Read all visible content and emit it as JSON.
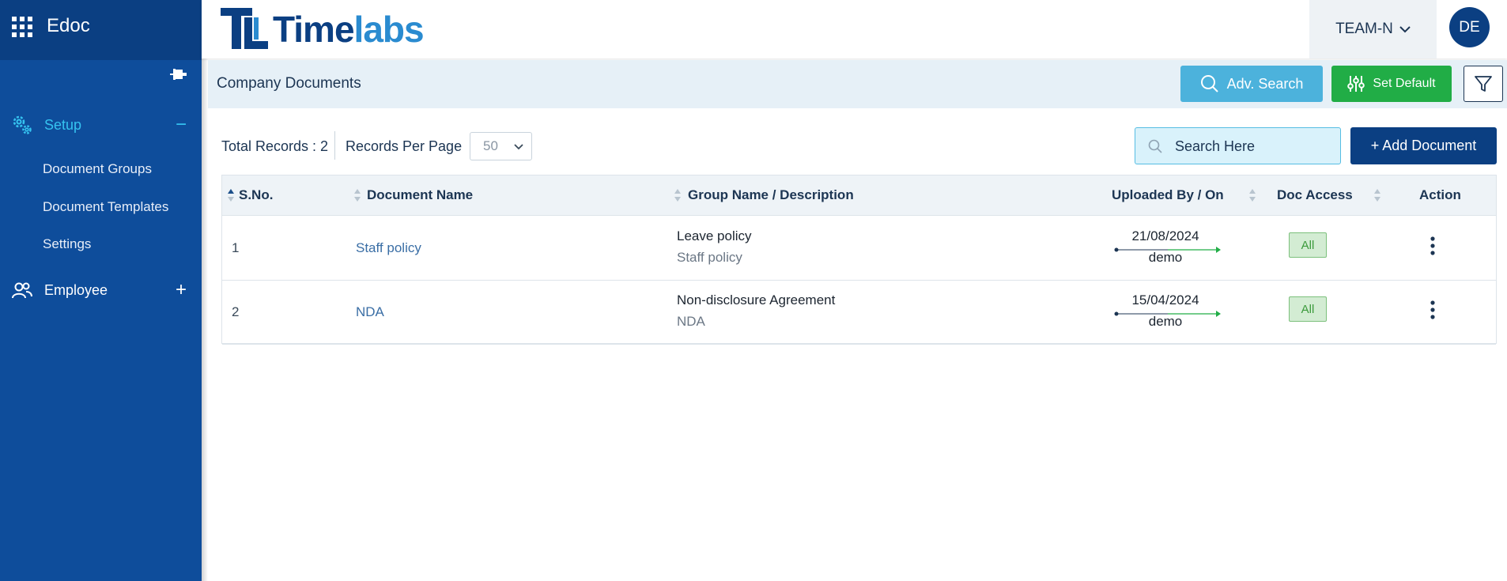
{
  "app": {
    "name": "Edoc"
  },
  "sidebar": {
    "sections": [
      {
        "label": "Setup",
        "toggle": "−",
        "active": true,
        "items": [
          {
            "label": "Document Groups"
          },
          {
            "label": "Document Templates"
          },
          {
            "label": "Settings"
          }
        ]
      },
      {
        "label": "Employee",
        "toggle": "+",
        "active": false,
        "items": []
      }
    ]
  },
  "header": {
    "logo_text_dark": "Time",
    "logo_text_light": "labs",
    "team": "TEAM-N",
    "avatar_initials": "DE"
  },
  "page": {
    "title": "Company Documents",
    "adv_search_label": "Adv. Search",
    "set_default_label": "Set Default",
    "total_records_label": "Total Records : 2",
    "records_per_page_label": "Records Per Page",
    "records_per_page_value": "50",
    "search_placeholder": "Search Here",
    "add_document_label": "+ Add Document"
  },
  "table": {
    "columns": [
      "S.No.",
      "Document Name",
      "Group Name / Description",
      "Uploaded By / On",
      "Doc Access",
      "Action"
    ],
    "rows": [
      {
        "sno": "1",
        "name": "Staff policy",
        "group": "Leave policy",
        "description": "Staff policy",
        "date": "21/08/2024",
        "by": "demo",
        "access": "All"
      },
      {
        "sno": "2",
        "name": "NDA",
        "group": "Non-disclosure Agreement",
        "description": "NDA",
        "date": "15/04/2024",
        "by": "demo",
        "access": "All"
      }
    ]
  },
  "colors": {
    "sidebar": "#0e4d9b",
    "sidebar_header": "#0b3f82",
    "active": "#35c3f0",
    "adv_search": "#4cb2dc",
    "set_default": "#21ad46",
    "add_document": "#0b3f82"
  },
  "icons": [
    "apps-grid-icon",
    "pin-icon",
    "gear-icon",
    "users-icon",
    "chevron-down-icon",
    "search-icon",
    "sliders-icon",
    "filter-icon",
    "more-vertical-icon",
    "sort-icon"
  ]
}
